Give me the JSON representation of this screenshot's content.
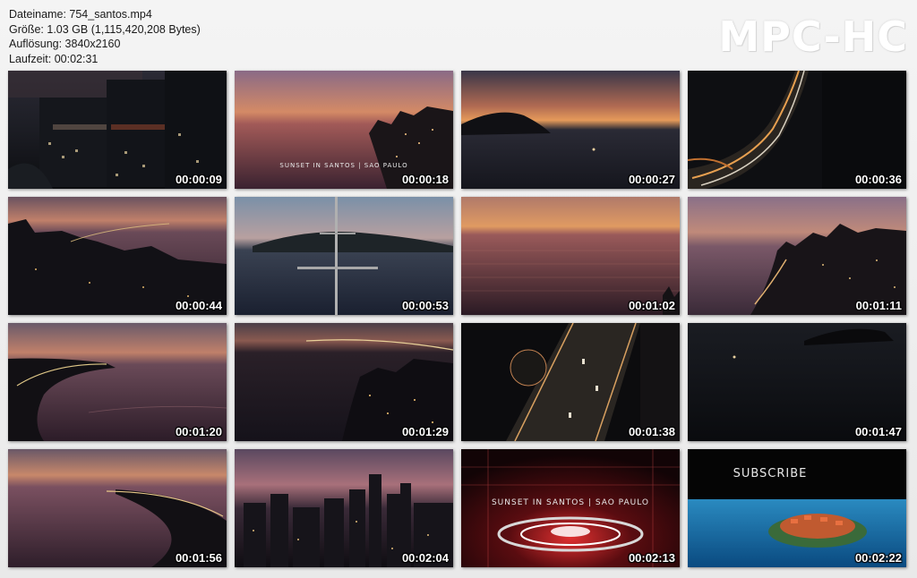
{
  "file_info": {
    "filename": "Dateiname: 754_santos.mp4",
    "size": "Größe: 1.03 GB (1,115,420,208 Bytes)",
    "resolution": "Auflösung: 3840x2160",
    "duration": "Laufzeit: 00:02:31"
  },
  "logo": "MPC-HC",
  "thumbnails": [
    {
      "time": "00:00:09"
    },
    {
      "time": "00:00:18",
      "caption": "SUNSET IN SANTOS | SAO PAULO"
    },
    {
      "time": "00:00:27"
    },
    {
      "time": "00:00:36"
    },
    {
      "time": "00:00:44"
    },
    {
      "time": "00:00:53"
    },
    {
      "time": "00:01:02"
    },
    {
      "time": "00:01:11"
    },
    {
      "time": "00:01:20"
    },
    {
      "time": "00:01:29"
    },
    {
      "time": "00:01:38"
    },
    {
      "time": "00:01:47"
    },
    {
      "time": "00:01:56"
    },
    {
      "time": "00:02:04"
    },
    {
      "time": "00:02:13",
      "caption": "SUNSET IN SANTOS | SAO PAULO"
    },
    {
      "time": "00:02:22",
      "caption": "SUBSCRIBE"
    }
  ],
  "colors": {
    "background": "#efefef",
    "sky_sunset": "#d9825a",
    "water_dusk": "#6b3c4a",
    "night": "#0e1014"
  }
}
